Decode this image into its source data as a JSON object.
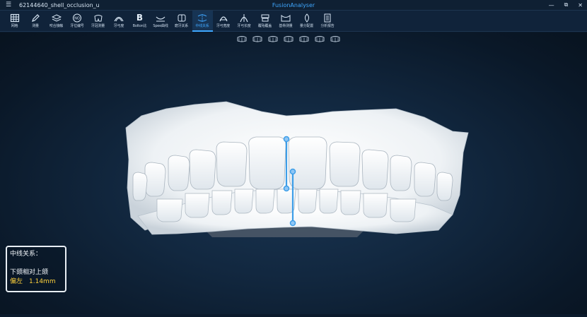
{
  "window": {
    "file_name": "62144640_shell_occlusion_u",
    "app_title": "FusionAnalyser",
    "menu_glyph": "☰",
    "controls": {
      "minimize": "—",
      "restore": "⧉",
      "close": "✕"
    }
  },
  "toolbar": [
    {
      "id": "grid",
      "label": "网格",
      "icon": "grid-icon"
    },
    {
      "id": "measure",
      "label": "测量",
      "icon": "pencil-icon"
    },
    {
      "id": "occlusal",
      "label": "咬合接触",
      "icon": "layers-icon"
    },
    {
      "id": "toothnum",
      "label": "牙位编号",
      "icon": "no-icon"
    },
    {
      "id": "toothmeasure",
      "label": "牙冠测量",
      "icon": "tooth-icon"
    },
    {
      "id": "arch",
      "label": "牙弓度",
      "icon": "arch-icon"
    },
    {
      "id": "bolton",
      "label": "Bolton比",
      "icon": "bolton-b-icon",
      "glyph": "B"
    },
    {
      "id": "spee",
      "label": "Spee曲线",
      "icon": "spee-curve-icon"
    },
    {
      "id": "molar",
      "label": "磨牙关系",
      "icon": "molar-icon"
    },
    {
      "id": "midline",
      "label": "中线关系",
      "icon": "midline-icon",
      "active": true
    },
    {
      "id": "archform",
      "label": "牙弓宽度",
      "icon": "archform-icon"
    },
    {
      "id": "archlength",
      "label": "牙弓长度",
      "icon": "archlength-icon"
    },
    {
      "id": "overbite",
      "label": "覆殆覆盖",
      "icon": "overbite-icon"
    },
    {
      "id": "basal",
      "label": "基骨测量",
      "icon": "basal-icon"
    },
    {
      "id": "space",
      "label": "量分配置",
      "icon": "space-icon"
    },
    {
      "id": "report",
      "label": "分析报告",
      "icon": "report-icon"
    }
  ],
  "subtools": [
    "view-top-icon",
    "view-occlusal-icon",
    "view-front-icon",
    "view-left-icon",
    "view-right-icon",
    "view-bottom-icon",
    "view-side-icon"
  ],
  "midline_panel": {
    "title": "中线关系：",
    "relation": "下颌相对上颌",
    "direction": "偏左",
    "value": "1.14mm"
  },
  "colors": {
    "accent": "#3fa7ff",
    "highlight": "#ffd23c",
    "measure_line": "#3d9ee8"
  }
}
